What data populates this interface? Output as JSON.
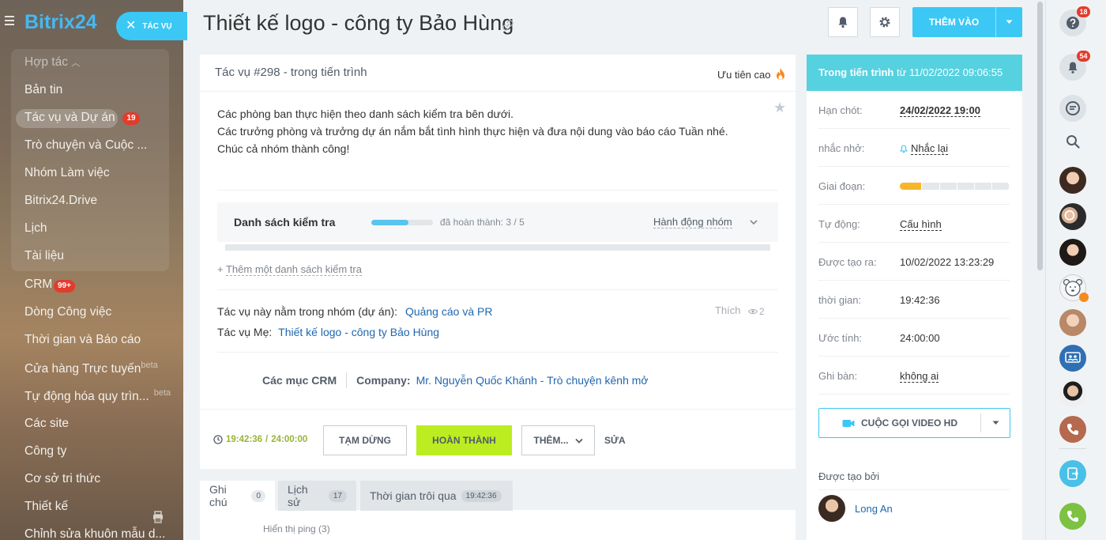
{
  "sidebar": {
    "logo_text": "Bitrix24",
    "task_pill_label": "TÁC VỤ",
    "items": [
      {
        "label": "Hợp tác",
        "type": "group"
      },
      {
        "label": "Bản tin"
      },
      {
        "label": "Tác vụ và Dự án",
        "counter": "19",
        "active": true
      },
      {
        "label": "Trò chuyện và Cuộc ..."
      },
      {
        "label": "Nhóm Làm việc"
      },
      {
        "label": "Bitrix24.Drive"
      },
      {
        "label": "Lịch"
      },
      {
        "label": "Tài liệu"
      },
      {
        "label": "CRM",
        "counter": "99+"
      },
      {
        "label": "Dòng Công việc"
      },
      {
        "label": "Thời gian và Báo cáo"
      },
      {
        "label": "Cửa hàng Trực tuyến",
        "sup": "beta"
      },
      {
        "label": "Tự động hóa quy trìn...",
        "sup": "beta"
      },
      {
        "label": "Các site"
      },
      {
        "label": "Công ty"
      },
      {
        "label": "Cơ sở tri thức"
      },
      {
        "label": "Thiết kế"
      },
      {
        "label": "Chỉnh sửa khuôn mẫu d..."
      }
    ]
  },
  "header": {
    "title": "Thiết kế logo - công ty Bảo Hùng",
    "add_button": "THÊM VÀO"
  },
  "task": {
    "number_status": "Tác vụ #298 - trong tiến trình",
    "priority": "Ưu tiên cao",
    "description": [
      "Các phòng ban thực hiện theo danh sách kiểm tra bên dưới.",
      "Các trưởng phòng và trưởng dự án nắm bắt tình hình thực hiện và đưa nội dung vào báo cáo Tuần nhé.",
      "Chúc cả nhóm thành công!"
    ],
    "checklist": {
      "title": "Danh sách kiểm tra",
      "done_text": "đã hoàn thành: 3 / 5",
      "progress_fraction": 0.6,
      "group_action": "Hành động nhóm"
    },
    "add_checklist_prefix": "+",
    "add_checklist": "Thêm một danh sách kiểm tra",
    "group_label": "Tác vụ này nằm trong nhóm (dự án):",
    "group_value": "Quảng cáo và PR",
    "parent_label": "Tác vụ Mẹ:",
    "parent_value": "Thiết kế logo - công ty Bảo Hùng",
    "like": "Thích",
    "views": "2",
    "crm_label": "Các mục CRM",
    "company_label": "Company:",
    "company_value": "Mr. Nguyễn Quốc Khánh - Trò chuyện kênh mở",
    "timer_elapsed": "19:42:36",
    "timer_sep": "/",
    "timer_total": "24:00:00",
    "buttons": {
      "pause": "TẠM DỪNG",
      "complete": "HOÀN THÀNH",
      "more": "THÊM...",
      "edit": "SỬA"
    }
  },
  "tabs": [
    {
      "label": "Ghi chú",
      "count": "0",
      "active": true
    },
    {
      "label": "Lịch sử",
      "count": "17"
    },
    {
      "label": "Thời gian trôi qua",
      "count": "19:42:36"
    }
  ],
  "ping_text": "Hiển thị ping (3)",
  "details": {
    "status_prefix": "Trong tiến trình",
    "status_suffix": "từ 11/02/2022 09:06:55",
    "rows": [
      {
        "key": "Hạn chót:",
        "value": "24/02/2022 19:00"
      },
      {
        "key": "nhắc nhở:",
        "value": "Nhắc lại"
      },
      {
        "key": "Giai đoạn:",
        "value": ""
      },
      {
        "key": "Tự động:",
        "value": "Cấu hình"
      },
      {
        "key": "Được tạo ra:",
        "value": "10/02/2022 13:23:29"
      },
      {
        "key": "thời gian:",
        "value": "19:42:36"
      },
      {
        "key": "Ước tính:",
        "value": "24:00:00"
      },
      {
        "key": "Ghi bàn:",
        "value": "không ai"
      }
    ],
    "stage_filled_segments": 1,
    "stage_total_segments": 6,
    "stage_color": "#f7b52a",
    "video_button": "CUỘC GỌI VIDEO HD",
    "created_by_label": "Được tạo bởi",
    "creator_name": "Long An"
  },
  "iconbar": {
    "help_badge": "18",
    "notifications_badge": "54"
  },
  "colors": {
    "accent": "#3bc8f5",
    "complete": "#bbed21",
    "status_header": "#56d1e0",
    "link": "#2067b0",
    "counter": "#e33b2c"
  }
}
